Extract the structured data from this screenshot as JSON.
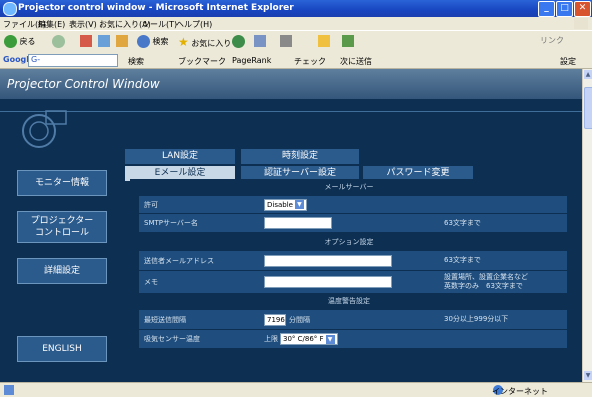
{
  "window": {
    "title": "Projector control window - Microsoft Internet Explorer",
    "minimize": "_",
    "maximize": "□",
    "close": "✕"
  },
  "menu": [
    "ファイル(F)",
    "編集(E)",
    "表示(V)",
    "お気に入り(A)",
    "ツール(T)",
    "ヘルプ(H)"
  ],
  "toolbar": {
    "back": "戻る",
    "favorites": "お気に入り",
    "search": "検索",
    "links": "リンク"
  },
  "googlebar": {
    "logo": "Google",
    "g_label": "G-",
    "search": "検索",
    "bookmarks": "ブックマーク",
    "pagerank": "PageRank",
    "check": "チェック",
    "send": "次に送信",
    "settings": "設定"
  },
  "page": {
    "title": "Projector Control Window",
    "nav": [
      {
        "label": "モニター情報"
      },
      {
        "label": "プロジェクター\nコントロール"
      },
      {
        "label": "詳細設定"
      },
      {
        "label": "ENGLISH"
      }
    ],
    "tabs_row1": [
      "LAN設定",
      "時刻設定"
    ],
    "tabs_row2": [
      "Eメール設定",
      "認証サーバー設定",
      "パスワード変更"
    ],
    "sections": {
      "mail_server": "メールサーバー",
      "options": "オプション設定",
      "temp_warning": "温度警告設定"
    },
    "rows": {
      "permit": {
        "label": "許可",
        "value": "Disable"
      },
      "smtp": {
        "label": "SMTPサーバー名",
        "note": "63文字まで"
      },
      "sender": {
        "label": "送信者メールアドレス",
        "note": "63文字まで"
      },
      "memo": {
        "label": "メモ",
        "note": "設置場所、設置企業名など\n英数字のみ　63文字まで"
      },
      "interval": {
        "label": "最短送信間隔",
        "value": "7196",
        "unit": "分間隔",
        "note": "30分以上999分以下"
      },
      "intake": {
        "label": "吸気センサー温度",
        "prefix": "上限",
        "value": "30° C/86° F"
      }
    }
  },
  "status": {
    "zone": "インターネット"
  }
}
